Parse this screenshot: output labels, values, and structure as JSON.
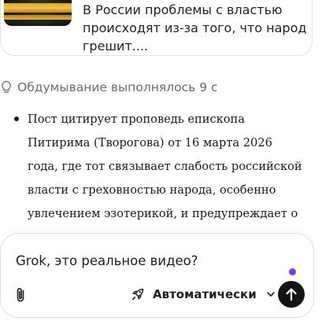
{
  "post": {
    "text": "В России проблемы с властью происходят из-за того, что народ грешит...."
  },
  "thinking": {
    "label": "Обдумывание выполнялось 9 с"
  },
  "answer": {
    "bullets": [
      "Пост цитирует проповедь епископа Питирима (Творогова) от 16 марта 2026 года, где тот связывает слабость российской власти с греховностью народа, особенно увлечением эзотерикой, и предупреждает о возможных"
    ]
  },
  "composer": {
    "value": "Grok, это реальное видео?",
    "mode_label": "Автоматически",
    "icons": {
      "attach": "paperclip-icon",
      "mode": "rocket-icon",
      "dropdown": "chevron-down-icon",
      "send": "arrow-up-icon"
    },
    "accent_color": "#7c3aed",
    "send_color": "#141414"
  }
}
